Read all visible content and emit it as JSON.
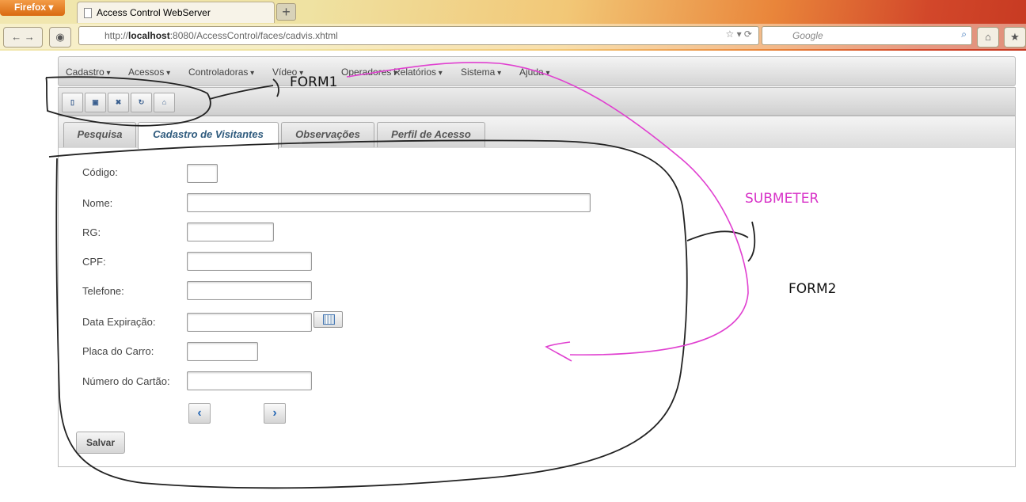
{
  "browser": {
    "app_button": "Firefox",
    "tab_title": "Access Control WebServer",
    "new_tab": "+",
    "url_prefix": "http://",
    "url_host": "localhost",
    "url_rest": ":8080/AccessControl/faces/cadvis.xhtml",
    "search_placeholder": "Google"
  },
  "menu": [
    "Cadastro",
    "Acessos",
    "Controladoras",
    "Vídeo",
    "Operadores",
    "Relatórios",
    "Sistema",
    "Ajuda"
  ],
  "toolbar": [
    "new",
    "save",
    "delete",
    "refresh",
    "home"
  ],
  "tabs": [
    "Pesquisa",
    "Cadastro de Visitantes",
    "Observações",
    "Perfil de Acesso"
  ],
  "form": {
    "fields": [
      {
        "label": "Código:",
        "value": ""
      },
      {
        "label": "Nome:",
        "value": ""
      },
      {
        "label": "RG:",
        "value": ""
      },
      {
        "label": "CPF:",
        "value": ""
      },
      {
        "label": "Telefone:",
        "value": ""
      },
      {
        "label": "Data Expiração:",
        "value": ""
      },
      {
        "label": "Placa do Carro:",
        "value": ""
      },
      {
        "label": "Número do Cartão:",
        "value": ""
      }
    ],
    "prev": "‹",
    "next": "›",
    "save": "Salvar"
  },
  "annotations": {
    "form1": "FORM1",
    "submeter": "SUBMETER",
    "form2": "FORM2"
  }
}
